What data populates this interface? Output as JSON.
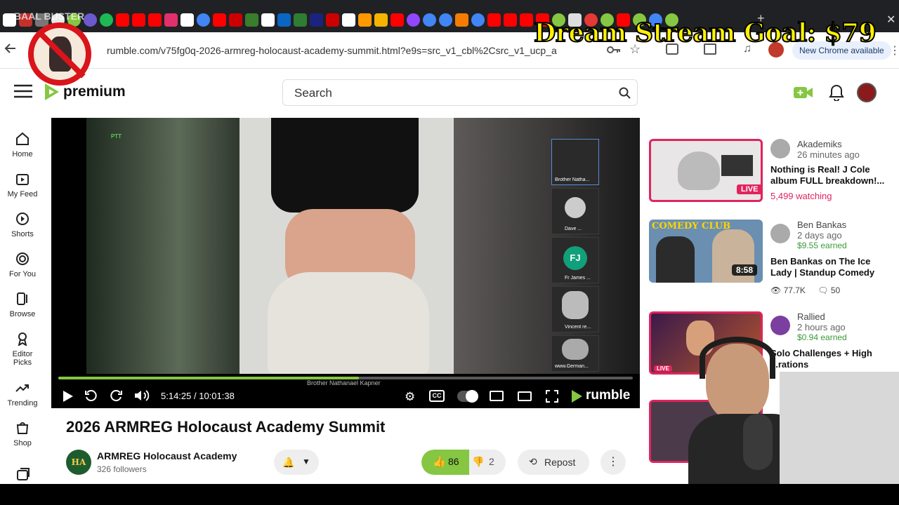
{
  "browser": {
    "url": "rumble.com/v75fg0q-2026-armreg-holocaust-academy-summit.html?e9s=src_v1_cbl%2Csrc_v1_ucp_a",
    "new_chrome_label": "New Chrome available",
    "tab_label": "BAAL BUSTER"
  },
  "site": {
    "logo_text": "premium",
    "search_placeholder": "Search",
    "accent": "#85c742"
  },
  "nav": {
    "items": [
      {
        "label": "Home",
        "icon": "home-icon"
      },
      {
        "label": "My Feed",
        "icon": "feed-icon"
      },
      {
        "label": "Shorts",
        "icon": "shorts-icon"
      },
      {
        "label": "For You",
        "icon": "target-icon"
      },
      {
        "label": "Browse",
        "icon": "browse-icon"
      },
      {
        "label": "Editor Picks",
        "icon": "ribbon-icon"
      },
      {
        "label": "Trending",
        "icon": "trending-icon"
      },
      {
        "label": "Shop",
        "icon": "shop-icon"
      }
    ]
  },
  "player": {
    "time": "5:14:25 / 10:01:38",
    "progress": 0.523,
    "speaker_caption": "Brother Nathanael Kapner",
    "brand": "rumble",
    "badge": "PTT",
    "participants": [
      {
        "name": "Brother Natha..."
      },
      {
        "name": "Dave ..."
      },
      {
        "name": "Fr James ...",
        "initials": "FJ"
      },
      {
        "name": "Vincent re..."
      },
      {
        "name": "www.German..."
      }
    ]
  },
  "video": {
    "title": "2026 ARMREG Holocaust Academy Summit",
    "channel": "ARMREG Holocaust Academy",
    "channel_initials": "HA",
    "followers": "326 followers",
    "likes": "86",
    "dislikes": "2",
    "repost_label": "Repost"
  },
  "recommendations": [
    {
      "channel": "Akademiks",
      "ago": "26 minutes ago",
      "title": "Nothing is Real! J Cole album FULL breakdown!...",
      "status": "5,499 watching",
      "badge": "LIVE"
    },
    {
      "channel": "Ben Bankas",
      "ago": "2 days ago",
      "earned": "$9.55 earned",
      "title": "Ben Bankas on The Ice Lady | Standup Comedy",
      "duration": "8:58",
      "views": "77.7K",
      "comments": "50",
      "thumb_text": "COMEDY CLUB"
    },
    {
      "channel": "Rallied",
      "ago": "2 hours ago",
      "earned": "$0.94 earned",
      "title": "Solo Challenges + High ...rations",
      "badge": "LIVE"
    }
  ],
  "overlay": {
    "goal_text": "Dream Stream Goal: $79"
  }
}
